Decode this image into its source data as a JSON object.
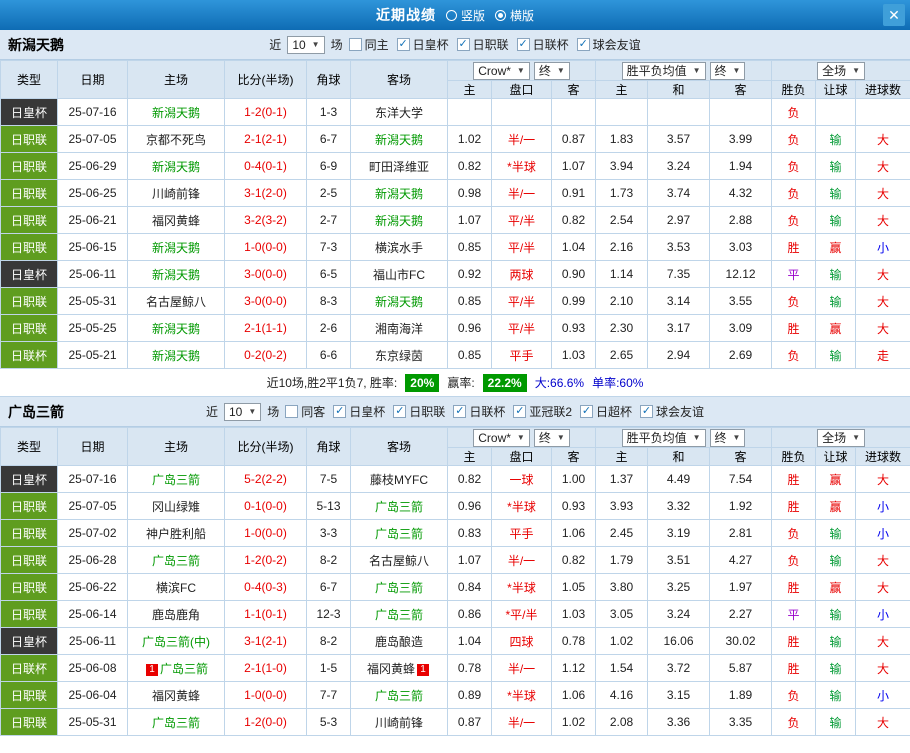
{
  "titlebar": {
    "title": "近期战绩",
    "vertical": "竖版",
    "horizontal": "横版",
    "close": "✕"
  },
  "filter": {
    "near": "近",
    "count": "10",
    "games": "场"
  },
  "selects": {
    "company": "Crow*",
    "final": "终",
    "europe": "胜平负均值",
    "scope": "全场"
  },
  "colors": {
    "accent_blue": "#1272b8",
    "type_green": "#5f9d1f",
    "type_dark": "#383838",
    "team_green": "#009900",
    "score_red": "#e80000",
    "badge_green": "#009900"
  },
  "table_header": {
    "type": "类型",
    "date": "日期",
    "home": "主场",
    "score": "比分(半场)",
    "corner": "角球",
    "away": "客场",
    "sub": {
      "h": "主",
      "pan": "盘口",
      "a": "客",
      "h2": "主",
      "draw": "和",
      "a2": "客",
      "result": "胜负",
      "handicap": "让球",
      "goals": "进球数"
    }
  },
  "sections": [
    {
      "team": "新潟天鹅",
      "checkboxes": [
        {
          "label": "同主",
          "checked": false
        },
        {
          "label": "日皇杯",
          "checked": true
        },
        {
          "label": "日职联",
          "checked": true
        },
        {
          "label": "日联杯",
          "checked": true
        },
        {
          "label": "球会友谊",
          "checked": true
        }
      ],
      "rows": [
        {
          "t": "日皇杯",
          "tc": "d",
          "d": "25-07-16",
          "h": "新潟天鹅",
          "hg": 1,
          "s": "1-2(0-1)",
          "c": "1-3",
          "a": "东洋大学",
          "ag": 0,
          "o": [
            "",
            "",
            ""
          ],
          "e": [
            "",
            "",
            ""
          ],
          "r": [
            "负",
            "red"
          ],
          "l": [
            "",
            ""
          ],
          "g": [
            "",
            ""
          ]
        },
        {
          "t": "日职联",
          "tc": "g",
          "d": "25-07-05",
          "h": "京都不死鸟",
          "hg": 0,
          "s": "2-1(2-1)",
          "c": "6-7",
          "a": "新潟天鹅",
          "ag": 1,
          "o": [
            "1.02",
            "半/一",
            "0.87"
          ],
          "e": [
            "1.83",
            "3.57",
            "3.99"
          ],
          "r": [
            "负",
            "red"
          ],
          "l": [
            "输",
            "green"
          ],
          "g": [
            "大",
            "red"
          ]
        },
        {
          "t": "日职联",
          "tc": "g",
          "d": "25-06-29",
          "h": "新潟天鹅",
          "hg": 1,
          "s": "0-4(0-1)",
          "c": "6-9",
          "a": "町田泽维亚",
          "ag": 0,
          "o": [
            "0.82",
            "*半球",
            "1.07"
          ],
          "e": [
            "3.94",
            "3.24",
            "1.94"
          ],
          "r": [
            "负",
            "red"
          ],
          "l": [
            "输",
            "green"
          ],
          "g": [
            "大",
            "red"
          ]
        },
        {
          "t": "日职联",
          "tc": "g",
          "d": "25-06-25",
          "h": "川崎前锋",
          "hg": 0,
          "s": "3-1(2-0)",
          "c": "2-5",
          "a": "新潟天鹅",
          "ag": 1,
          "o": [
            "0.98",
            "半/一",
            "0.91"
          ],
          "e": [
            "1.73",
            "3.74",
            "4.32"
          ],
          "r": [
            "负",
            "red"
          ],
          "l": [
            "输",
            "green"
          ],
          "g": [
            "大",
            "red"
          ]
        },
        {
          "t": "日职联",
          "tc": "g",
          "d": "25-06-21",
          "h": "福冈黄蜂",
          "hg": 0,
          "s": "3-2(3-2)",
          "c": "2-7",
          "a": "新潟天鹅",
          "ag": 1,
          "o": [
            "1.07",
            "平/半",
            "0.82"
          ],
          "e": [
            "2.54",
            "2.97",
            "2.88"
          ],
          "r": [
            "负",
            "red"
          ],
          "l": [
            "输",
            "green"
          ],
          "g": [
            "大",
            "red"
          ]
        },
        {
          "t": "日职联",
          "tc": "g",
          "d": "25-06-15",
          "h": "新潟天鹅",
          "hg": 1,
          "s": "1-0(0-0)",
          "c": "7-3",
          "a": "横滨水手",
          "ag": 0,
          "o": [
            "0.85",
            "平/半",
            "1.04"
          ],
          "e": [
            "2.16",
            "3.53",
            "3.03"
          ],
          "r": [
            "胜",
            "red"
          ],
          "l": [
            "赢",
            "red"
          ],
          "g": [
            "小",
            "blue"
          ]
        },
        {
          "t": "日皇杯",
          "tc": "d",
          "d": "25-06-11",
          "h": "新潟天鹅",
          "hg": 1,
          "s": "3-0(0-0)",
          "c": "6-5",
          "a": "福山市FC",
          "ag": 0,
          "o": [
            "0.92",
            "两球",
            "0.90"
          ],
          "e": [
            "1.14",
            "7.35",
            "12.12"
          ],
          "r": [
            "平",
            "purple"
          ],
          "l": [
            "输",
            "green"
          ],
          "g": [
            "大",
            "red"
          ]
        },
        {
          "t": "日职联",
          "tc": "g",
          "d": "25-05-31",
          "h": "名古屋鲸八",
          "hg": 0,
          "s": "3-0(0-0)",
          "c": "8-3",
          "a": "新潟天鹅",
          "ag": 1,
          "o": [
            "0.85",
            "平/半",
            "0.99"
          ],
          "e": [
            "2.10",
            "3.14",
            "3.55"
          ],
          "r": [
            "负",
            "red"
          ],
          "l": [
            "输",
            "green"
          ],
          "g": [
            "大",
            "red"
          ]
        },
        {
          "t": "日职联",
          "tc": "g",
          "d": "25-05-25",
          "h": "新潟天鹅",
          "hg": 1,
          "s": "2-1(1-1)",
          "c": "2-6",
          "a": "湘南海洋",
          "ag": 0,
          "o": [
            "0.96",
            "平/半",
            "0.93"
          ],
          "e": [
            "2.30",
            "3.17",
            "3.09"
          ],
          "r": [
            "胜",
            "red"
          ],
          "l": [
            "赢",
            "red"
          ],
          "g": [
            "大",
            "red"
          ]
        },
        {
          "t": "日联杯",
          "tc": "g",
          "d": "25-05-21",
          "h": "新潟天鹅",
          "hg": 1,
          "s": "0-2(0-2)",
          "c": "6-6",
          "a": "东京绿茵",
          "ag": 0,
          "o": [
            "0.85",
            "平手",
            "1.03"
          ],
          "e": [
            "2.65",
            "2.94",
            "2.69"
          ],
          "r": [
            "负",
            "red"
          ],
          "l": [
            "输",
            "green"
          ],
          "g": [
            "走",
            "red"
          ]
        }
      ],
      "footer": {
        "summary": "近10场,胜2平1负7, 胜率:",
        "win_rate": "20%",
        "profit_label": "赢率:",
        "profit_rate": "22.2%",
        "big_rate": "大:66.6%",
        "single_rate": "单率:60%"
      }
    },
    {
      "team": "广岛三箭",
      "checkboxes": [
        {
          "label": "同客",
          "checked": false
        },
        {
          "label": "日皇杯",
          "checked": true
        },
        {
          "label": "日职联",
          "checked": true
        },
        {
          "label": "日联杯",
          "checked": true
        },
        {
          "label": "亚冠联2",
          "checked": true
        },
        {
          "label": "日超杯",
          "checked": true
        },
        {
          "label": "球会友谊",
          "checked": true
        }
      ],
      "rows": [
        {
          "t": "日皇杯",
          "tc": "d",
          "d": "25-07-16",
          "h": "广岛三箭",
          "hg": 1,
          "s": "5-2(2-2)",
          "c": "7-5",
          "a": "藤枝MYFC",
          "ag": 0,
          "o": [
            "0.82",
            "一球",
            "1.00"
          ],
          "e": [
            "1.37",
            "4.49",
            "7.54"
          ],
          "r": [
            "胜",
            "red"
          ],
          "l": [
            "赢",
            "red"
          ],
          "g": [
            "大",
            "red"
          ]
        },
        {
          "t": "日职联",
          "tc": "g",
          "d": "25-07-05",
          "h": "冈山绿雉",
          "hg": 0,
          "s": "0-1(0-0)",
          "c": "5-13",
          "a": "广岛三箭",
          "ag": 1,
          "o": [
            "0.96",
            "*半球",
            "0.93"
          ],
          "e": [
            "3.93",
            "3.32",
            "1.92"
          ],
          "r": [
            "胜",
            "red"
          ],
          "l": [
            "赢",
            "red"
          ],
          "g": [
            "小",
            "blue"
          ]
        },
        {
          "t": "日职联",
          "tc": "g",
          "d": "25-07-02",
          "h": "神户胜利船",
          "hg": 0,
          "s": "1-0(0-0)",
          "c": "3-3",
          "a": "广岛三箭",
          "ag": 1,
          "o": [
            "0.83",
            "平手",
            "1.06"
          ],
          "e": [
            "2.45",
            "3.19",
            "2.81"
          ],
          "r": [
            "负",
            "red"
          ],
          "l": [
            "输",
            "green"
          ],
          "g": [
            "小",
            "blue"
          ]
        },
        {
          "t": "日职联",
          "tc": "g",
          "d": "25-06-28",
          "h": "广岛三箭",
          "hg": 1,
          "s": "1-2(0-2)",
          "c": "8-2",
          "a": "名古屋鲸八",
          "ag": 0,
          "o": [
            "1.07",
            "半/一",
            "0.82"
          ],
          "e": [
            "1.79",
            "3.51",
            "4.27"
          ],
          "r": [
            "负",
            "red"
          ],
          "l": [
            "输",
            "green"
          ],
          "g": [
            "大",
            "red"
          ]
        },
        {
          "t": "日职联",
          "tc": "g",
          "d": "25-06-22",
          "h": "横滨FC",
          "hg": 0,
          "s": "0-4(0-3)",
          "c": "6-7",
          "a": "广岛三箭",
          "ag": 1,
          "o": [
            "0.84",
            "*半球",
            "1.05"
          ],
          "e": [
            "3.80",
            "3.25",
            "1.97"
          ],
          "r": [
            "胜",
            "red"
          ],
          "l": [
            "赢",
            "red"
          ],
          "g": [
            "大",
            "red"
          ]
        },
        {
          "t": "日职联",
          "tc": "g",
          "d": "25-06-14",
          "h": "鹿岛鹿角",
          "hg": 0,
          "s": "1-1(0-1)",
          "c": "12-3",
          "a": "广岛三箭",
          "ag": 1,
          "o": [
            "0.86",
            "*平/半",
            "1.03"
          ],
          "e": [
            "3.05",
            "3.24",
            "2.27"
          ],
          "r": [
            "平",
            "purple"
          ],
          "l": [
            "输",
            "green"
          ],
          "g": [
            "小",
            "blue"
          ]
        },
        {
          "t": "日皇杯",
          "tc": "d",
          "d": "25-06-11",
          "h": "广岛三箭(中)",
          "hg": 1,
          "s": "3-1(2-1)",
          "c": "8-2",
          "a": "鹿岛酿造",
          "ag": 0,
          "o": [
            "1.04",
            "四球",
            "0.78"
          ],
          "e": [
            "1.02",
            "16.06",
            "30.02"
          ],
          "r": [
            "胜",
            "red"
          ],
          "l": [
            "输",
            "green"
          ],
          "g": [
            "大",
            "red"
          ]
        },
        {
          "t": "日联杯",
          "tc": "g",
          "d": "25-06-08",
          "h": "广岛三箭",
          "hg": 1,
          "hb": "1",
          "s": "2-1(1-0)",
          "c": "1-5",
          "a": "福冈黄蜂",
          "ag": 0,
          "ab": "1",
          "o": [
            "0.78",
            "半/一",
            "1.12"
          ],
          "e": [
            "1.54",
            "3.72",
            "5.87"
          ],
          "r": [
            "胜",
            "red"
          ],
          "l": [
            "输",
            "green"
          ],
          "g": [
            "大",
            "red"
          ]
        },
        {
          "t": "日职联",
          "tc": "g",
          "d": "25-06-04",
          "h": "福冈黄蜂",
          "hg": 0,
          "s": "1-0(0-0)",
          "c": "7-7",
          "a": "广岛三箭",
          "ag": 1,
          "o": [
            "0.89",
            "*半球",
            "1.06"
          ],
          "e": [
            "4.16",
            "3.15",
            "1.89"
          ],
          "r": [
            "负",
            "red"
          ],
          "l": [
            "输",
            "green"
          ],
          "g": [
            "小",
            "blue"
          ]
        },
        {
          "t": "日职联",
          "tc": "g",
          "d": "25-05-31",
          "h": "广岛三箭",
          "hg": 1,
          "s": "1-2(0-0)",
          "c": "5-3",
          "a": "川崎前锋",
          "ag": 0,
          "o": [
            "0.87",
            "半/一",
            "1.02"
          ],
          "e": [
            "2.08",
            "3.36",
            "3.35"
          ],
          "r": [
            "负",
            "red"
          ],
          "l": [
            "输",
            "green"
          ],
          "g": [
            "大",
            "red"
          ]
        }
      ]
    }
  ]
}
